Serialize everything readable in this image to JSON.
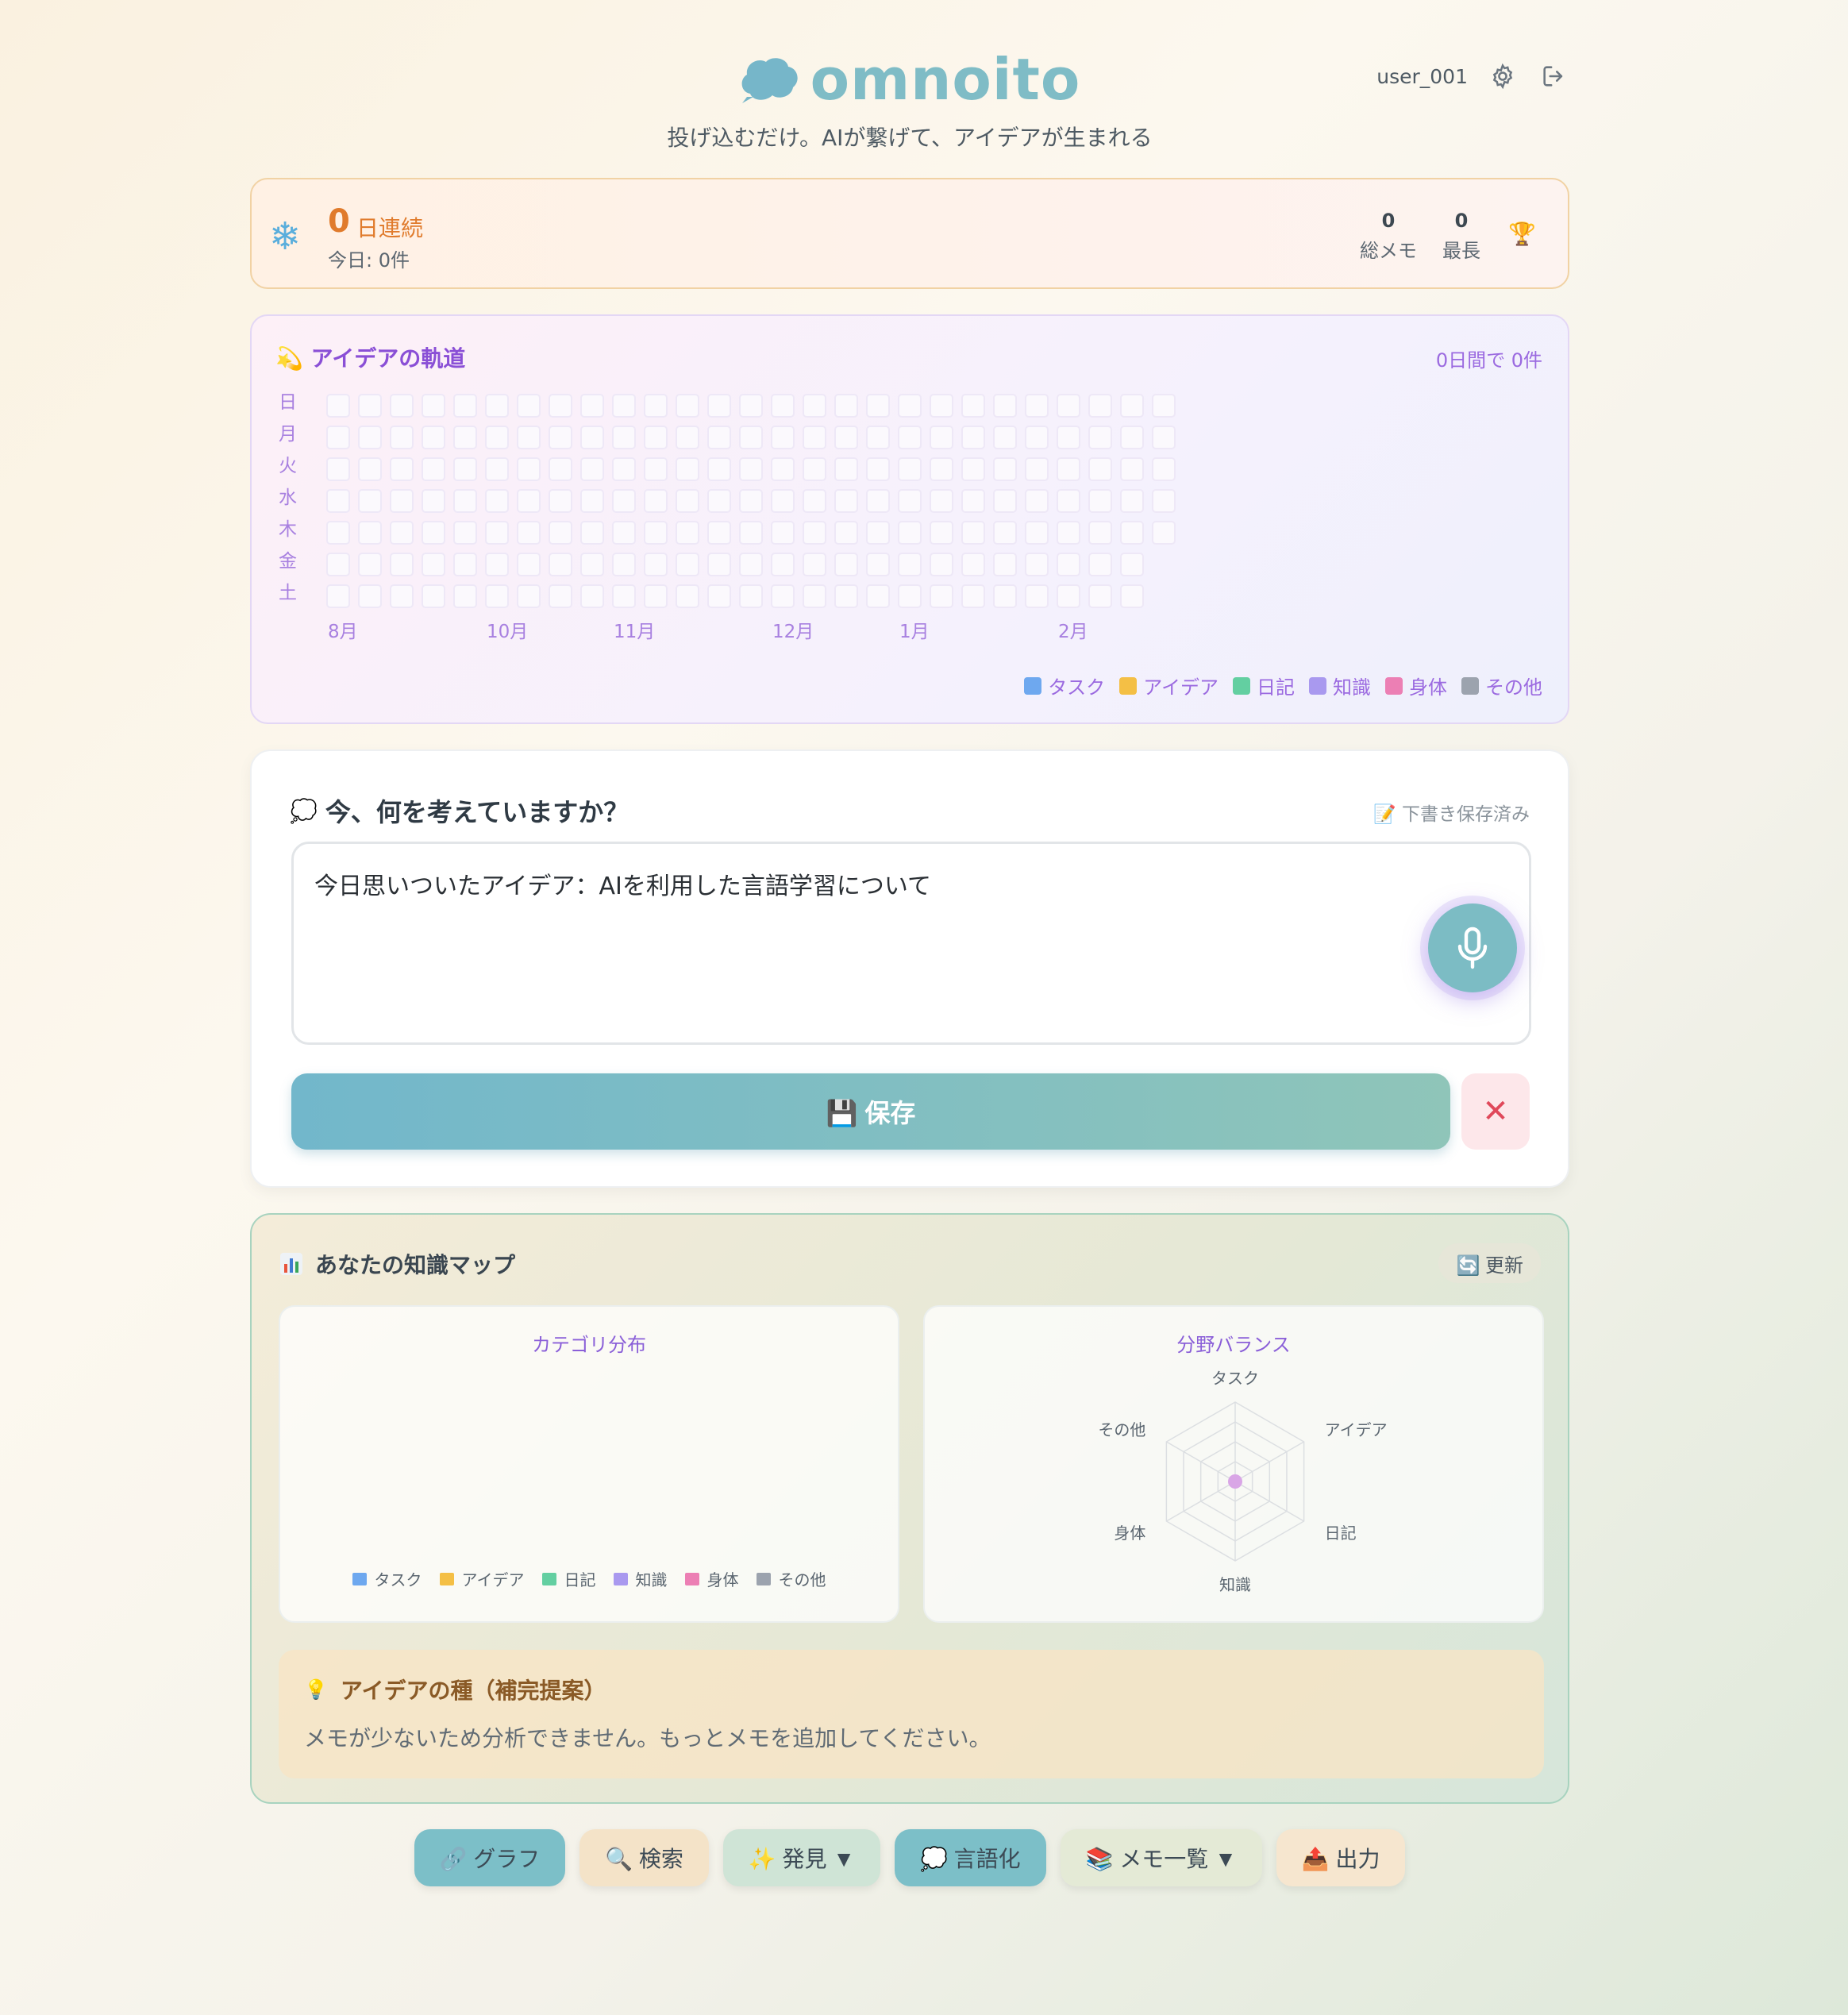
{
  "header": {
    "brand": "omnoito",
    "tagline": "投げ込むだけ。AIが繋げて、アイデアが生まれる",
    "username": "user_001"
  },
  "streak": {
    "icon": "snowflake-icon",
    "days": "0",
    "unit": "日連続",
    "today": "今日: 0件",
    "total_value": "0",
    "total_label": "総メモ",
    "longest_value": "0",
    "longest_label": "最長"
  },
  "trajectory": {
    "title": "💫 アイデアの軌道",
    "count": "0日間で 0件",
    "days": [
      "日",
      "月",
      "火",
      "水",
      "木",
      "金",
      "土"
    ],
    "months": [
      "8月",
      "10月",
      "11月",
      "12月",
      "1月",
      "2月"
    ],
    "legend": [
      {
        "label": "タスク",
        "color": "#6ea8ef"
      },
      {
        "label": "アイデア",
        "color": "#f4bf45"
      },
      {
        "label": "日記",
        "color": "#63cfa1"
      },
      {
        "label": "知識",
        "color": "#a999ef"
      },
      {
        "label": "身体",
        "color": "#ec7fb4"
      },
      {
        "label": "その他",
        "color": "#9ca3ae"
      }
    ]
  },
  "input": {
    "title": "今、何を考えていますか？",
    "draft_status": "📝 下書き保存済み",
    "text": "今日思いついたアイデア：AIを利用した言語学習について",
    "save_label": "💾 保存",
    "clear_label": "✕"
  },
  "kmap": {
    "title": "あなたの知識マップ",
    "refresh_label": "🔄 更新",
    "category_title": "カテゴリ分布",
    "balance_title": "分野バランス",
    "radar_axes": [
      "タスク",
      "アイデア",
      "日記",
      "知識",
      "身体",
      "その他"
    ],
    "radar_values": [
      0,
      0,
      0,
      0,
      0,
      0
    ],
    "seed_title": "アイデアの種（補完提案）",
    "seed_text": "メモが少ないため分析できません。もっとメモを追加してください。"
  },
  "nav": [
    {
      "label": "🔗 グラフ",
      "bg": "#7cbfc8"
    },
    {
      "label": "🔍 検索",
      "bg": "#f4e3c8"
    },
    {
      "label": "✨ 発見 ▼",
      "bg": "#cfe4d6"
    },
    {
      "label": "💭 言語化",
      "bg": "#7cbfc8"
    },
    {
      "label": "📚 メモ一覧 ▼",
      "bg": "#e4ead6"
    },
    {
      "label": "📤 出力",
      "bg": "#f6e6cf"
    }
  ]
}
